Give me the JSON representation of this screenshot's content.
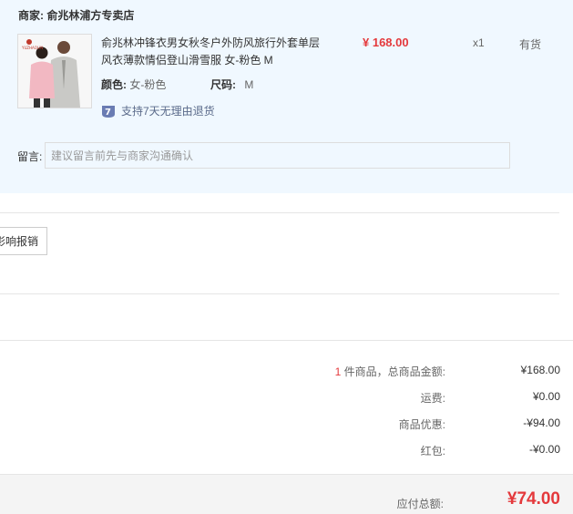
{
  "shop": {
    "merchant_label": "商家:",
    "merchant_name": "俞兆林浦方专卖店",
    "product": {
      "title": "俞兆林冲锋衣男女秋冬户外防风旅行外套单层风衣薄款情侣登山滑雪服 女-粉色 M",
      "price": "¥ 168.00",
      "qty": "x1",
      "stock": "有货",
      "color_label": "颜色:",
      "color_value": "女-粉色",
      "size_label": "尺码:",
      "size_value": "M",
      "return_text": "支持7天无理由退货",
      "return_icon": "seven-day-return-icon",
      "thumb_brand": "YUZHAOLIN"
    },
    "memo_label": "留言:",
    "memo_placeholder": "建议留言前先与商家沟通确认"
  },
  "invoice": {
    "button_label": "影响报销"
  },
  "summary": {
    "items_count": "1",
    "items_label": "件商品，总商品金额:",
    "items_total": "¥168.00",
    "shipping_label": "运费:",
    "shipping_value": "¥0.00",
    "discount_label": "商品优惠:",
    "discount_value": "-¥94.00",
    "redpacket_label": "红包:",
    "redpacket_value": "-¥0.00",
    "payable_label": "应付总额:",
    "payable_value": "¥74.00"
  },
  "colors": {
    "accent_red": "#e4393c",
    "panel_bg": "#f0f8ff"
  }
}
